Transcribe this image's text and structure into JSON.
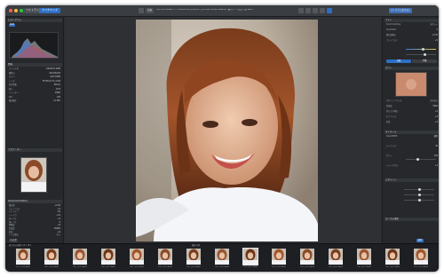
{
  "window": {
    "title": "DxO PhotoLab 5 — 20220205_DSC0017_Portrait Model Session (東京) — 写真_人物.ARW",
    "tab_library": "フォトライブラリー",
    "tab_customize": "カスタマイズ",
    "toolbar_compare": "比較",
    "toolbar_right_btn": "書き出し",
    "toolbar_top_right": "ディスクに書き出し"
  },
  "left_panel": {
    "histogram_header": "ヒストグラム",
    "histogram_mode": "RGB",
    "exif_header": "情報",
    "exif_rows": [
      {
        "label": "ファイル名",
        "value": "DSC0017.ARW"
      },
      {
        "label": "撮影日",
        "value": "2022/02/05"
      },
      {
        "label": "カメラ",
        "value": "ILCE-7RM4"
      },
      {
        "label": "レンズ",
        "value": "FE 85mm F1.4 GM"
      },
      {
        "label": "焦点距離",
        "value": "85mm"
      },
      {
        "label": "絞り",
        "value": "f/1.8"
      },
      {
        "label": "シャッター",
        "value": "1/800"
      },
      {
        "label": "ISO",
        "value": "100"
      },
      {
        "label": "露出補正",
        "value": "+0.3EV"
      }
    ],
    "nav_header": "ナビゲーター",
    "keywords_header": "Advanced History",
    "history_rows": [
      {
        "label": "露光量",
        "value": "+0.30"
      },
      {
        "label": "コントラスト",
        "value": "+5"
      },
      {
        "label": "ハイライト",
        "value": "-20"
      },
      {
        "label": "シャドウ",
        "value": "+12"
      },
      {
        "label": "白レベル",
        "value": "+4"
      },
      {
        "label": "黒レベル",
        "value": "-3"
      },
      {
        "label": "明瞭度",
        "value": "+8"
      },
      {
        "label": "色温度",
        "value": "5600K"
      },
      {
        "label": "彩度",
        "value": "+6"
      },
      {
        "label": "レンズ補正",
        "value": "オン"
      }
    ],
    "footer_button": "ヘルプ"
  },
  "right_panel": {
    "light_header": "ライト",
    "light_rows": [
      {
        "label": "Smart Lighting",
        "value": "スポット"
      },
      {
        "label": "ClearView",
        "value": "0"
      },
      {
        "label": "露光量補正",
        "value": "+0.30"
      },
      {
        "label": "コントラスト",
        "value": "+5"
      }
    ],
    "toggle_a": "自動",
    "toggle_b": "手動",
    "color_header": "カラー",
    "tone_rows": [
      {
        "label": "ホワイトバランス",
        "value": "カスタム"
      },
      {
        "label": "色温度",
        "value": "5600"
      },
      {
        "label": "色かぶり補正",
        "value": "+2"
      },
      {
        "label": "ビブランス",
        "value": "+6"
      },
      {
        "label": "彩度",
        "value": "+4"
      }
    ],
    "detail_header": "ディテール",
    "detail_rows": [
      {
        "label": "DeepPRIME",
        "value": "適用"
      },
      {
        "label": "ルミナンス",
        "value": "40"
      },
      {
        "label": "カラー",
        "value": "100"
      },
      {
        "label": "シャープネス",
        "value": "+2"
      }
    ],
    "geometry_header": "ジオメトリ",
    "local_header": "ローカル補正",
    "apply_button": "適用"
  },
  "filmstrip": {
    "count_label": "表示中の画像: 23 / 142",
    "sort_label": "撮影日時",
    "items": [
      {
        "label": "DSC_0008.ARW"
      },
      {
        "label": "DSC_0009.ARW"
      },
      {
        "label": "DSC_0010.ARW"
      },
      {
        "label": "DSC_0011.ARW"
      },
      {
        "label": "DSC_0012.ARW"
      },
      {
        "label": "DSC_0013.ARW"
      },
      {
        "label": "DSC_0014.ARW"
      },
      {
        "label": "DSC_0015.ARW"
      },
      {
        "label": "DSC_0017.ARW"
      },
      {
        "label": "DSC_0018.ARW"
      },
      {
        "label": "DSC_0019.ARW"
      },
      {
        "label": "DSC_0020.ARW"
      },
      {
        "label": "DSC_0021.ARW"
      },
      {
        "label": "DSC_0022.ARW"
      },
      {
        "label": "DSC_0023.ARW"
      }
    ]
  },
  "colors": {
    "accent": "#2e6fc4",
    "panel_bg": "#26282b",
    "strip_bg": "#1e1f22"
  }
}
